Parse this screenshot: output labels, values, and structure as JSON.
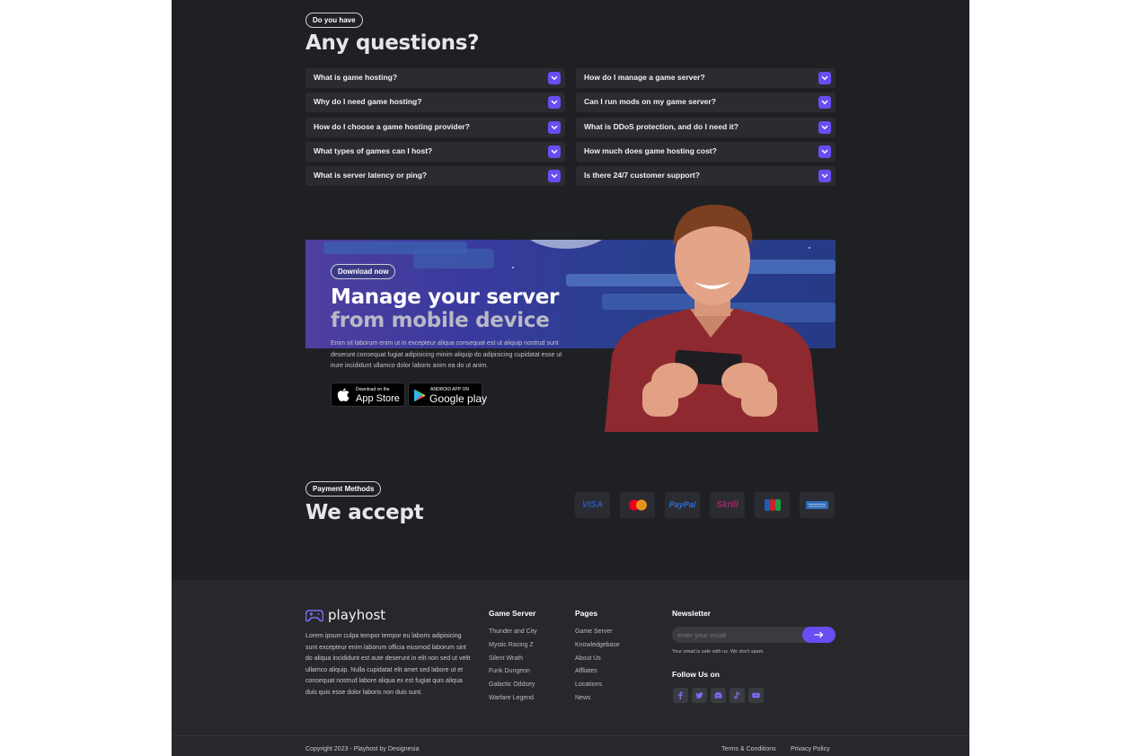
{
  "faq": {
    "badge": "Do you have",
    "title": "Any questions?",
    "left": [
      "What is game hosting?",
      "Why do I need game hosting?",
      "How do I choose a game hosting provider?",
      "What types of games can I host?",
      "What is server latency or ping?"
    ],
    "right": [
      "How do I manage a game server?",
      "Can I run mods on my game server?",
      "What is DDoS protection, and do I need it?",
      "How much does game hosting cost?",
      "Is there 24/7 customer support?"
    ]
  },
  "app": {
    "badge": "Download now",
    "title_line1": "Manage your server",
    "title_line2": "from mobile device",
    "description": "Enim sit laborum enim ut in excepteur aliqua consequat est ut aliquip nostrud sunt deserunt consequat fugiat adipisicing minim aliquip do adipisicing cupidatat esse ut irure incididunt ullamco dolor laboris anim ea do ut anim.",
    "appstore_small": "Download on the",
    "appstore_big": "App Store",
    "googleplay_small": "ANDROID APP ON",
    "googleplay_big": "Google play"
  },
  "payment": {
    "badge": "Payment Methods",
    "title": "We accept",
    "methods": [
      "VISA",
      "Mastercard",
      "PayPal",
      "Skrill",
      "JCB",
      "American Express"
    ]
  },
  "footer": {
    "brand": "playhost",
    "about": "Lorem ipsum culpa tempor tempor eu laboris adipisicing sunt excepteur enim laborum officia eiusmod laborum sint do aliqua incididunt est aute deserunt in elit non sed ut velit ullamco aliquip. Nulla cupidatat elit amet sed labore ut et consequat nostrud labore aliqua ex est fugiat quis aliqua duis quis esse dolor laboris non duis sunt.",
    "game_server_title": "Game Server",
    "game_server_links": [
      "Thunder and City",
      "Mystic Racing Z",
      "Silent Wrath",
      "Funk Dungeon",
      "Galactic Oddsey",
      "Warfare Legend"
    ],
    "pages_title": "Pages",
    "pages_links": [
      "Game Server",
      "Knowledgebase",
      "About Us",
      "Affliates",
      "Locations",
      "News"
    ],
    "newsletter_title": "Newsletter",
    "newsletter_placeholder": "enter your email",
    "newsletter_note": "Your email is safe with us. We don't spam.",
    "follow_title": "Follow Us on",
    "social": [
      "facebook-icon",
      "twitter-icon",
      "discord-icon",
      "tiktok-icon",
      "youtube-icon"
    ],
    "copyright": "Copyright 2023 - Playhost by Designesia",
    "terms": "Terms & Conditions",
    "privacy": "Privacy Policy"
  },
  "colors": {
    "accent": "#6a4df2",
    "background": "#1f2024",
    "card": "#2b2c31"
  }
}
